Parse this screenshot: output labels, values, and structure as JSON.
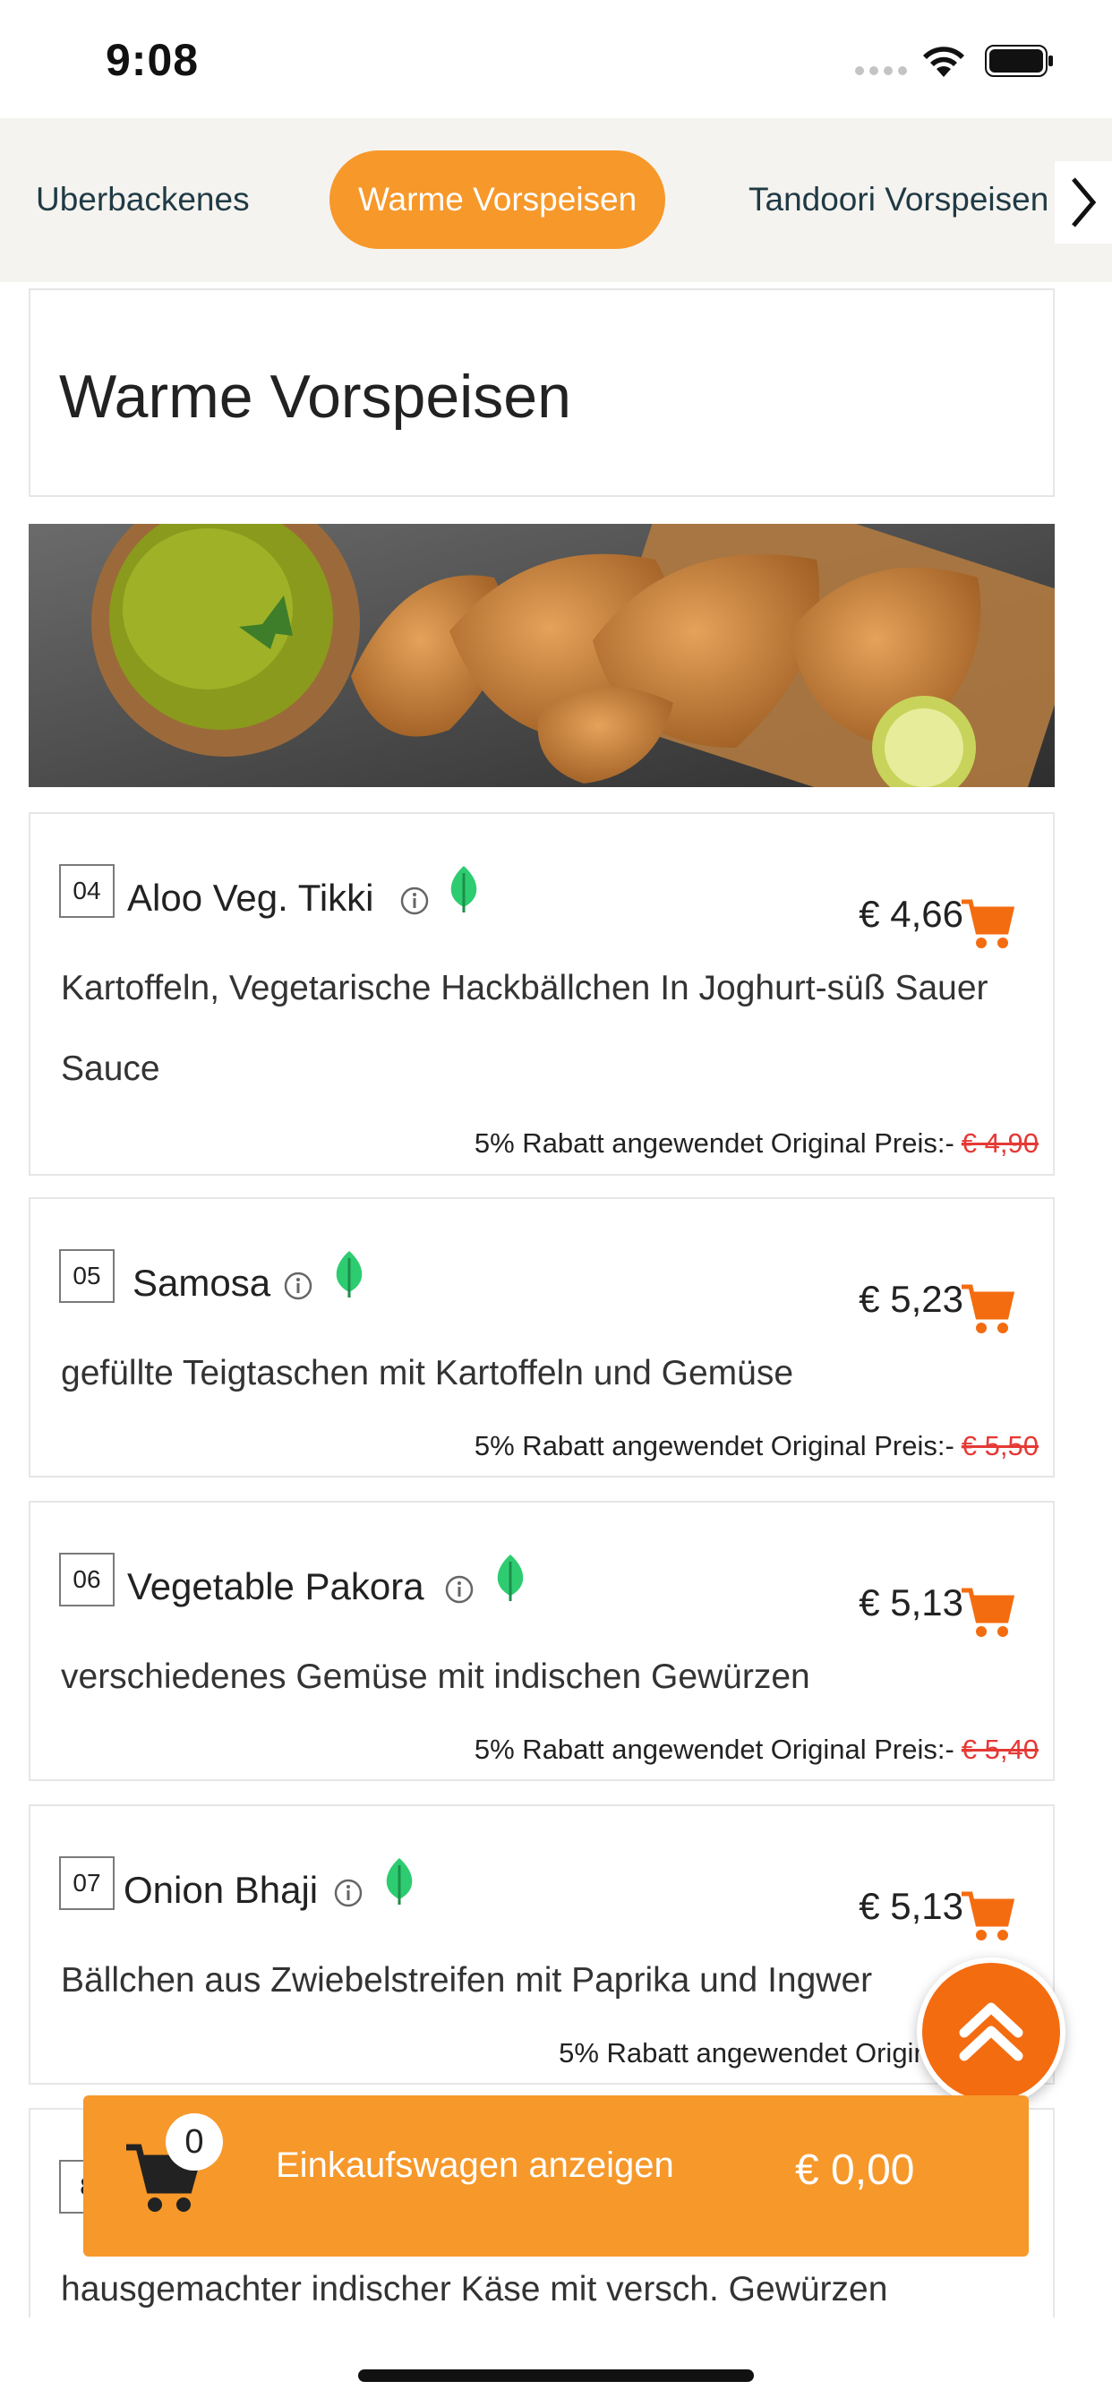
{
  "status_bar": {
    "time": "9:08"
  },
  "categories": [
    {
      "label": "Uberbackenes",
      "active": false
    },
    {
      "label": "Warme Vorspeisen",
      "active": true
    },
    {
      "label": "Tandoori Vorspeisen",
      "active": false
    }
  ],
  "section": {
    "title": "Warme Vorspeisen"
  },
  "items": [
    {
      "number": "04",
      "name": "Aloo Veg. Tikki",
      "price": "€ 4,66",
      "description": "Kartoffeln, Vegetarische Hackbällchen In Joghurt-süß Sauer Sauce",
      "discount_text": "5% Rabatt angewendet Original Preis:-",
      "original_price": "€ 4,90"
    },
    {
      "number": "05",
      "name": "Samosa",
      "price": "€ 5,23",
      "description": "gefüllte Teigtaschen mit Kartoffeln und Gemüse",
      "discount_text": "5% Rabatt angewendet Original Preis:-",
      "original_price": "€ 5,50"
    },
    {
      "number": "06",
      "name": "Vegetable Pakora",
      "price": "€ 5,13",
      "description": "verschiedenes Gemüse mit indischen Gewürzen",
      "discount_text": "5% Rabatt angewendet Original Preis:-",
      "original_price": "€ 5,40"
    },
    {
      "number": "07",
      "name": "Onion Bhaji",
      "price": "€ 5,13",
      "description": "Bällchen aus Zwiebelstreifen mit Paprika und Ingwer",
      "discount_text": "5% Rabatt angewendet Original Preis:-",
      "original_price": ""
    },
    {
      "number": "8",
      "name": "",
      "price": "",
      "description": "hausgemachter indischer Käse mit versch. Gewürzen",
      "discount_text": "",
      "original_price": ""
    }
  ],
  "cart": {
    "count": "0",
    "label": "Einkaufswagen anzeigen",
    "total": "€ 0,00"
  },
  "colors": {
    "accent": "#f7982a",
    "fab": "#f46c10",
    "cart_icon": "#f46c10",
    "leaf": "#2ecc71",
    "strike": "#e53935"
  },
  "icons": [
    "info-icon",
    "leaf-icon",
    "cart-icon",
    "chevron-right-icon",
    "double-chevron-up-icon",
    "wifi-icon",
    "battery-icon"
  ]
}
